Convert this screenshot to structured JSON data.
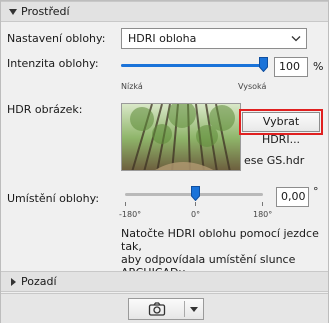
{
  "sections": {
    "environment": {
      "title": "Prostředí",
      "expanded": true
    },
    "background": {
      "title": "Pozadí",
      "expanded": false
    }
  },
  "sky_setting": {
    "label": "Nastavení oblohy:",
    "value": "HDRI obloha"
  },
  "sky_intensity": {
    "label": "Intenzita oblohy:",
    "min_label": "Nízká",
    "max_label": "Vysoká",
    "value": "100",
    "unit": "%",
    "level_percent": 100
  },
  "hdr_image": {
    "label": "HDR obrázek:",
    "button_label": "Vybrat HDRI...",
    "filename": "ese GS.hdr"
  },
  "sky_position": {
    "label": "Umístění oblohy:",
    "tick_min": "-180°",
    "tick_mid": "0°",
    "tick_max": "180°",
    "value": "0,00",
    "unit": "°",
    "note": [
      "Natočte HDRI oblohu pomocí jezdce tak,",
      "aby odpovídala umístění slunce",
      "ARCHICADu."
    ]
  },
  "toolbar": {
    "camera_icon": "camera-icon",
    "dropdown_icon": "caret-down-icon"
  },
  "colors": {
    "accent": "#1a73d9",
    "highlight": "#e02020"
  }
}
